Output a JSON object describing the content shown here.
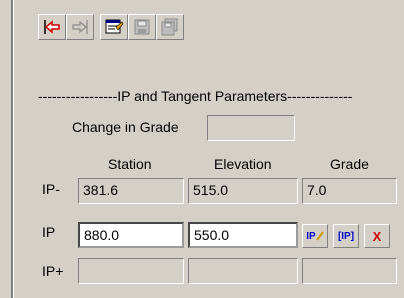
{
  "toolbar": {
    "buttons": [
      {
        "icon": "red-arrow-back-icon",
        "enabled": true
      },
      {
        "icon": "arrow-forward-icon",
        "enabled": false
      },
      {
        "icon": "properties-icon",
        "enabled": true
      },
      {
        "icon": "save-icon",
        "enabled": false
      },
      {
        "icon": "save-all-icon",
        "enabled": false
      }
    ]
  },
  "section": {
    "title": "-----------------IP and Tangent Parameters--------------",
    "change_in_grade_label": "Change in Grade",
    "change_in_grade_value": ""
  },
  "columns": {
    "station": "Station",
    "elevation": "Elevation",
    "grade": "Grade"
  },
  "rows": {
    "ip_minus": {
      "label": "IP-",
      "station": "381.6",
      "elevation": "515.0",
      "grade": "7.0"
    },
    "ip": {
      "label": "IP",
      "station": "880.0",
      "elevation": "550.0",
      "buttons": [
        "IP",
        "[IP]",
        "X"
      ]
    },
    "ip_plus": {
      "label": "IP+",
      "station": "",
      "elevation": "",
      "grade": ""
    }
  },
  "colors": {
    "face": "#d4d0c8",
    "accent_red": "#cc0000",
    "accent_blue": "#0000cc"
  }
}
